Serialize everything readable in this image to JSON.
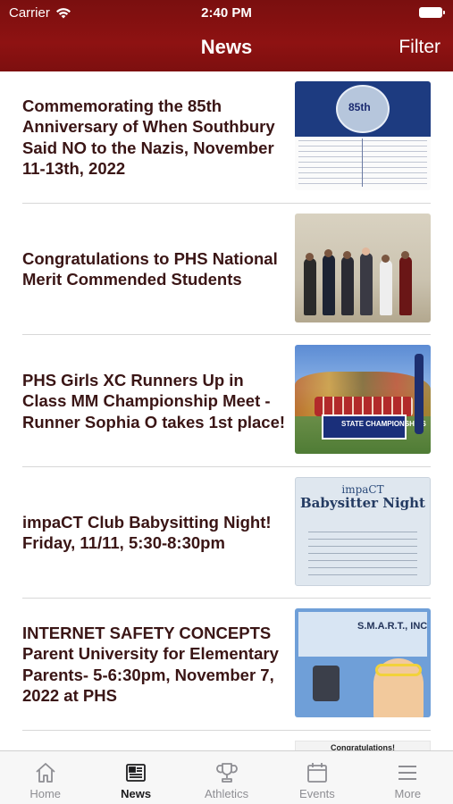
{
  "status_bar": {
    "carrier": "Carrier",
    "time": "2:40 PM"
  },
  "nav": {
    "title": "News",
    "filter_label": "Filter"
  },
  "news": [
    {
      "title": "Commemorating the 85th Anniversary of When Southbury Said NO to the Nazis, November 11-13th, 2022",
      "thumb_text": "85th"
    },
    {
      "title": "Congratulations to PHS National Merit Commended Students"
    },
    {
      "title": "PHS Girls XC Runners Up in Class MM Championship Meet - Runner Sophia O takes 1st place!",
      "thumb_text": "STATE CHAMPIONSHIPS"
    },
    {
      "title": "impaCT Club Babysitting Night! Friday, 11/11, 5:30-8:30pm",
      "thumb_text_1": "impaCT",
      "thumb_text_2": "Babysitter Night"
    },
    {
      "title": "INTERNET SAFETY CONCEPTS Parent University for Elementary Parents- 5-6:30pm, November 7, 2022 at PHS",
      "thumb_text": "S.M.A.R.T., INC"
    }
  ],
  "partial_item": {
    "thumb_text": "Congratulations!"
  },
  "tabbar": {
    "active": "news",
    "tabs": [
      {
        "label": "Home"
      },
      {
        "label": "News"
      },
      {
        "label": "Athletics"
      },
      {
        "label": "Events"
      },
      {
        "label": "More"
      }
    ]
  },
  "colors": {
    "header": "#8e1212",
    "title_text": "#3a1515",
    "tab_inactive": "#8e8e93",
    "tab_active": "#1c1c1e"
  }
}
